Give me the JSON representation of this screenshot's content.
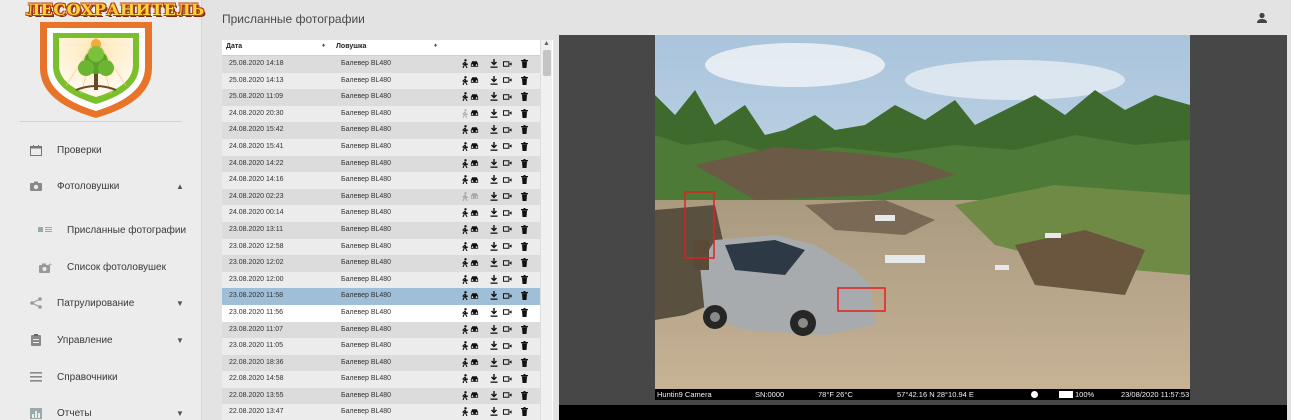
{
  "app": {
    "logo_text": "ЛЕСОХРАНИТЕЛЬ"
  },
  "sidebar": {
    "items": [
      {
        "label": "Проверки",
        "icon": "calendar-icon",
        "chevron": ""
      },
      {
        "label": "Фотоловушки",
        "icon": "camera-icon",
        "chevron": "▲"
      },
      {
        "label": "Присланные фотографии",
        "icon": "photo-list-icon",
        "chevron": ""
      },
      {
        "label": "Список фотоловушек",
        "icon": "camera-add-icon",
        "chevron": ""
      },
      {
        "label": "Патрулирование",
        "icon": "share-icon",
        "chevron": "▼"
      },
      {
        "label": "Управление",
        "icon": "clipboard-icon",
        "chevron": "▼"
      },
      {
        "label": "Справочники",
        "icon": "list-icon",
        "chevron": ""
      },
      {
        "label": "Отчеты",
        "icon": "chart-icon",
        "chevron": "▼"
      }
    ]
  },
  "header": {
    "title": "Присланные фотографии"
  },
  "table": {
    "columns": {
      "date": "Дата",
      "trap": "Ловушка",
      "sort_mark": "♦"
    },
    "rows": [
      {
        "date": "25.08.2020 14:18",
        "trap": "Балевер BL480"
      },
      {
        "date": "25.08.2020 14:13",
        "trap": "Балевер BL480"
      },
      {
        "date": "25.08.2020 11:09",
        "trap": "Балевер BL480"
      },
      {
        "date": "24.08.2020 20:30",
        "trap": "Балевер BL480"
      },
      {
        "date": "24.08.2020 15:42",
        "trap": "Балевер BL480"
      },
      {
        "date": "24.08.2020 15:41",
        "trap": "Балевер BL480"
      },
      {
        "date": "24.08.2020 14:22",
        "trap": "Балевер BL480"
      },
      {
        "date": "24.08.2020 14:16",
        "trap": "Балевер BL480"
      },
      {
        "date": "24.08.2020 02:23",
        "trap": "Балевер BL480"
      },
      {
        "date": "24.08.2020 00:14",
        "trap": "Балевер BL480"
      },
      {
        "date": "23.08.2020 13:11",
        "trap": "Балевер BL480"
      },
      {
        "date": "23.08.2020 12:58",
        "trap": "Балевер BL480"
      },
      {
        "date": "23.08.2020 12:02",
        "trap": "Балевер BL480"
      },
      {
        "date": "23.08.2020 12:00",
        "trap": "Балевер BL480"
      },
      {
        "date": "23.08.2020 11:58",
        "trap": "Балевер BL480"
      },
      {
        "date": "23.08.2020 11:56",
        "trap": "Балевер BL480"
      },
      {
        "date": "23.08.2020 11:07",
        "trap": "Балевер BL480"
      },
      {
        "date": "23.08.2020 11:05",
        "trap": "Балевер BL480"
      },
      {
        "date": "22.08.2020 18:36",
        "trap": "Балевер BL480"
      },
      {
        "date": "22.08.2020 14:58",
        "trap": "Балевер BL480"
      },
      {
        "date": "22.08.2020 13:55",
        "trap": "Балевер BL480"
      },
      {
        "date": "22.08.2020 13:47",
        "trap": "Балевер BL480"
      }
    ]
  },
  "viewer": {
    "caption": {
      "camera": "Huntin9 Camera",
      "sn": "SN:0000",
      "temp": "78°F  26°C",
      "coords": "57°42.16 N  28°10.94 E",
      "battery": "100%",
      "timestamp": "23/08/2020 11:57:53"
    }
  },
  "colors": {
    "selected_row": "#9fbfd8",
    "detection_box": "#e02020"
  }
}
